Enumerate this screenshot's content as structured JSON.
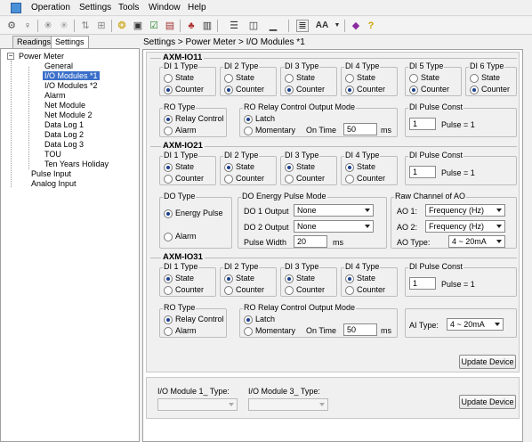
{
  "menubar": {
    "items": [
      "Operation",
      "Settings",
      "Tools",
      "Window",
      "Help"
    ]
  },
  "toolbar": {
    "icons": [
      "gear-icon",
      "bulb-icon",
      "asterisk-icon",
      "asterisk-disabled-icon",
      "sort-icon",
      "grid-icon",
      "chip-icon",
      "screen-icon",
      "check-icon",
      "chart-icon",
      "device-icon",
      "columns-icon",
      "split-icon",
      "minimize-icon",
      "listing-icon",
      "font-size-icon",
      "dropdown-icon",
      "book-icon",
      "help-icon"
    ]
  },
  "tabs": [
    "Readings",
    "Settings"
  ],
  "breadcrumb": "Settings > Power Meter > I/O Modules *1",
  "tree": {
    "power_meter": "Power Meter",
    "general": "General",
    "io1": "I/O Modules *1",
    "io2": "I/O Modules *2",
    "alarm": "Alarm",
    "net1": "Net Module",
    "net2": "Net Module 2",
    "log1": "Data Log 1",
    "log2": "Data Log 2",
    "log3": "Data Log 3",
    "tou": "TOU",
    "holiday": "Ten Years Holiday",
    "pulse_input": "Pulse Input",
    "analog_input": "Analog Input"
  },
  "axm11": {
    "title": "AXM-IO11",
    "di": [
      {
        "label": "DI 1 Type",
        "opt1": "State",
        "opt2": "Counter",
        "selected": "Counter"
      },
      {
        "label": "DI 2 Type",
        "opt1": "State",
        "opt2": "Counter",
        "selected": "Counter"
      },
      {
        "label": "DI 3 Type",
        "opt1": "State",
        "opt2": "Counter",
        "selected": "Counter"
      },
      {
        "label": "DI 4 Type",
        "opt1": "State",
        "opt2": "Counter",
        "selected": "Counter"
      },
      {
        "label": "DI 5 Type",
        "opt1": "State",
        "opt2": "Counter",
        "selected": "Counter"
      },
      {
        "label": "DI 6 Type",
        "opt1": "State",
        "opt2": "Counter",
        "selected": "Counter"
      }
    ],
    "ro_type": {
      "label": "RO Type",
      "opt1": "Relay Control",
      "opt2": "Alarm",
      "selected": "Relay Control"
    },
    "ro_mode": {
      "label": "RO Relay Control Output Mode",
      "opt1": "Latch",
      "opt2": "Momentary",
      "selected": "Latch",
      "on_time_label": "On Time",
      "on_time_value": "50",
      "unit": "ms"
    },
    "pulse": {
      "label": "DI Pulse Const",
      "value": "1",
      "text": "Pulse = 1"
    }
  },
  "axm21": {
    "title": "AXM-IO21",
    "di": [
      {
        "label": "DI 1 Type",
        "opt1": "State",
        "opt2": "Counter",
        "selected": "State"
      },
      {
        "label": "DI 2 Type",
        "opt1": "State",
        "opt2": "Counter",
        "selected": "State"
      },
      {
        "label": "DI 3 Type",
        "opt1": "State",
        "opt2": "Counter",
        "selected": "State"
      },
      {
        "label": "DI 4 Type",
        "opt1": "State",
        "opt2": "Counter",
        "selected": "State"
      }
    ],
    "pulse": {
      "label": "DI Pulse Const",
      "value": "1",
      "text": "Pulse = 1"
    },
    "do_type": {
      "label": "DO Type",
      "opt1": "Energy Pulse",
      "opt2": "Alarm",
      "selected": "Energy Pulse"
    },
    "do_mode": {
      "label": "DO Energy Pulse Mode",
      "do1_label": "DO 1 Output",
      "do1_value": "None",
      "do2_label": "DO 2 Output",
      "do2_value": "None",
      "width_label": "Pulse Width",
      "width_value": "20",
      "unit": "ms"
    },
    "ao": {
      "label": "Raw Channel of AO",
      "ao1_label": "AO 1:",
      "ao1_value": "Frequency (Hz)",
      "ao2_label": "AO 2:",
      "ao2_value": "Frequency (Hz)",
      "type_label": "AO Type:",
      "type_value": "4 ~ 20mA"
    }
  },
  "axm31": {
    "title": "AXM-IO31",
    "di": [
      {
        "label": "DI 1 Type",
        "opt1": "State",
        "opt2": "Counter",
        "selected": "State"
      },
      {
        "label": "DI 2 Type",
        "opt1": "State",
        "opt2": "Counter",
        "selected": "State"
      },
      {
        "label": "DI 3 Type",
        "opt1": "State",
        "opt2": "Counter",
        "selected": "State"
      },
      {
        "label": "DI 4 Type",
        "opt1": "State",
        "opt2": "Counter",
        "selected": "State"
      }
    ],
    "pulse": {
      "label": "DI Pulse Const",
      "value": "1",
      "text": "Pulse = 1"
    },
    "ro_type": {
      "label": "RO Type",
      "opt1": "Relay Control",
      "opt2": "Alarm",
      "selected": "Relay Control"
    },
    "ro_mode": {
      "label": "RO Relay Control Output Mode",
      "opt1": "Latch",
      "opt2": "Momentary",
      "selected": "Latch",
      "on_time_label": "On Time",
      "on_time_value": "50",
      "unit": "ms"
    },
    "ai": {
      "label": "AI Type:",
      "value": "4 ~ 20mA"
    }
  },
  "update_button": "Update Device",
  "lower": {
    "io1_label": "I/O Module 1_ Type:",
    "io3_label": "I/O Module 3_ Type:",
    "update_button": "Update Device"
  }
}
